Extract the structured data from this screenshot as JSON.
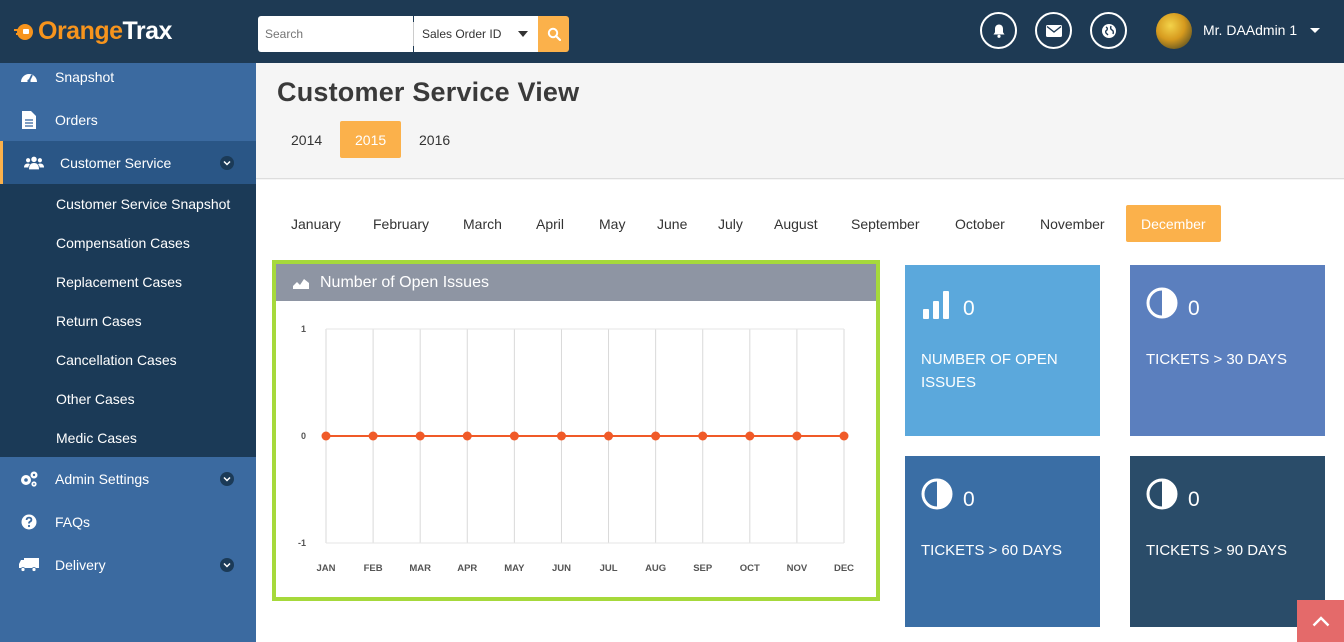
{
  "app": {
    "logo_part1": "Orange",
    "logo_part2": "Trax"
  },
  "header": {
    "search_placeholder": "Search",
    "search_filter": "Sales Order ID",
    "user_name": "Mr. DAAdmin 1",
    "icons": [
      "bell-icon",
      "envelope-icon",
      "globe-icon"
    ]
  },
  "sidebar": {
    "items": [
      {
        "label": "Snapshot",
        "icon": "dashboard-icon"
      },
      {
        "label": "Orders",
        "icon": "file-icon"
      },
      {
        "label": "Customer Service",
        "icon": "users-icon"
      },
      {
        "label": "Admin Settings",
        "icon": "gears-icon"
      },
      {
        "label": "FAQs",
        "icon": "question-icon"
      },
      {
        "label": "Delivery",
        "icon": "truck-icon"
      }
    ],
    "sub_items": [
      "Customer Service Snapshot",
      "Compensation Cases",
      "Replacement Cases",
      "Return Cases",
      "Cancellation Cases",
      "Other Cases",
      "Medic Cases"
    ]
  },
  "page": {
    "title": "Customer Service View",
    "years": [
      "2014",
      "2015",
      "2016"
    ],
    "active_year": "2015",
    "months": [
      "January",
      "February",
      "March",
      "April",
      "May",
      "June",
      "July",
      "August",
      "September",
      "October",
      "November",
      "December"
    ],
    "active_month": "December"
  },
  "panel": {
    "title": "Number of Open Issues"
  },
  "chart_data": {
    "type": "line",
    "title": "Number of Open Issues",
    "categories": [
      "JAN",
      "FEB",
      "MAR",
      "APR",
      "MAY",
      "JUN",
      "JUL",
      "AUG",
      "SEP",
      "OCT",
      "NOV",
      "DEC"
    ],
    "values": [
      0,
      0,
      0,
      0,
      0,
      0,
      0,
      0,
      0,
      0,
      0,
      0
    ],
    "ylim": [
      -1,
      1
    ],
    "yticks": [
      "1",
      "0",
      "-1"
    ],
    "grid": true,
    "line_color": "#f05a28"
  },
  "tiles": [
    {
      "value": "0",
      "label": "NUMBER OF OPEN ISSUES",
      "icon": "bar-chart-icon",
      "color": "#5ba8dc"
    },
    {
      "value": "0",
      "label": "TICKETS > 30 DAYS",
      "icon": "half-circle-icon",
      "color": "#5b7fbe"
    },
    {
      "value": "0",
      "label": "TICKETS > 60 DAYS",
      "icon": "half-circle-icon",
      "color": "#3a6ea5"
    },
    {
      "value": "0",
      "label": "TICKETS > 90 DAYS",
      "icon": "half-circle-icon",
      "color": "#2a4c69"
    }
  ]
}
